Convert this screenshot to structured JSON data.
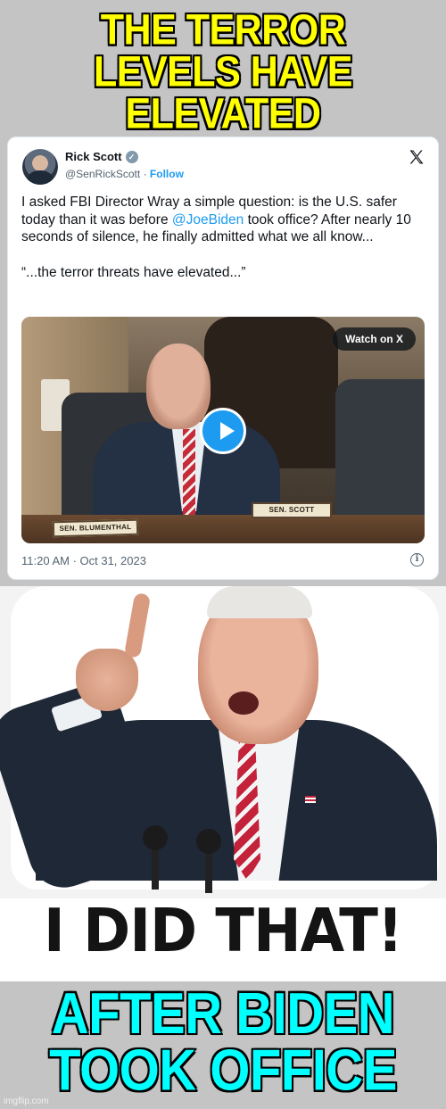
{
  "top_caption": {
    "line1": "THE TERROR",
    "line2": "LEVELS HAVE ELEVATED",
    "color": "#ffff00"
  },
  "tweet": {
    "author_name": "Rick Scott",
    "verified_icon": "verified-check-icon",
    "handle": "@SenRickScott",
    "separator": "·",
    "follow_label": "Follow",
    "platform_icon": "x-logo-icon",
    "text_part1": "I asked FBI Director Wray a simple question: is the U.S. safer today than it was before ",
    "mention": "@JoeBiden",
    "text_part2": " took office? After nearly 10 seconds of silence, he finally admitted what we all know...",
    "quote": "“...the terror threats have elevated...”",
    "video": {
      "watch_label": "Watch on X",
      "play_icon": "play-icon",
      "nameplate_left": "SEN. BLUMENTHAL",
      "nameplate_right": "SEN. SCOTT"
    },
    "timestamp": "11:20 AM · Oct 31, 2023",
    "info_icon": "info-icon",
    "link_color": "#1d9bf0"
  },
  "meme_panel": {
    "text": "I DID THAT!"
  },
  "bottom_caption": {
    "line1": "AFTER BIDEN",
    "line2": "TOOK OFFICE",
    "color": "#00ffff"
  },
  "watermark": "imgflip.com"
}
